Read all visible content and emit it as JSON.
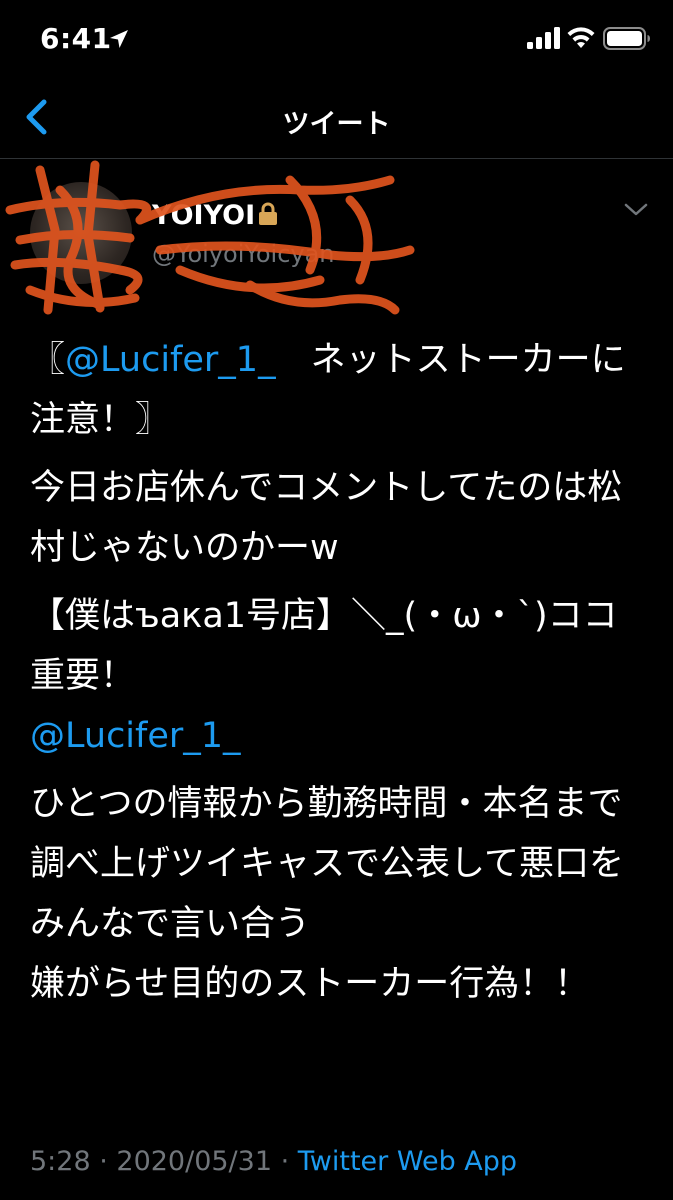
{
  "status_bar": {
    "time": "6:41"
  },
  "nav": {
    "title": "ツイート"
  },
  "author": {
    "display_name": "YOIYOI",
    "handle": "@YoiyoiYoicyan"
  },
  "tweet": {
    "line1": {
      "open": "〖",
      "mention": "@Lucifer_1_",
      "text": "　ネットストーカーに注意！〗"
    },
    "para2": "今日お店休んでコメントしてたのは松村じゃないのかーw",
    "para3": "【僕はъака1号店】＼_(・ω・`)ココ重要！",
    "mention2": "@Lucifer_1_",
    "para4": "ひとつの情報から勤務時間・本名まで調べ上げツイキャスで公表して悪口をみんなで言い合う",
    "para5": "嫌がらせ目的のストーカー行為！！"
  },
  "meta": {
    "time": "5:28",
    "sep1": " · ",
    "date": "2020/05/31",
    "sep2": " · ",
    "source": "Twitter Web App"
  },
  "colors": {
    "background": "#000000",
    "link": "#1d9bf0",
    "muted": "#71767b",
    "scribble": "#e0541e"
  }
}
